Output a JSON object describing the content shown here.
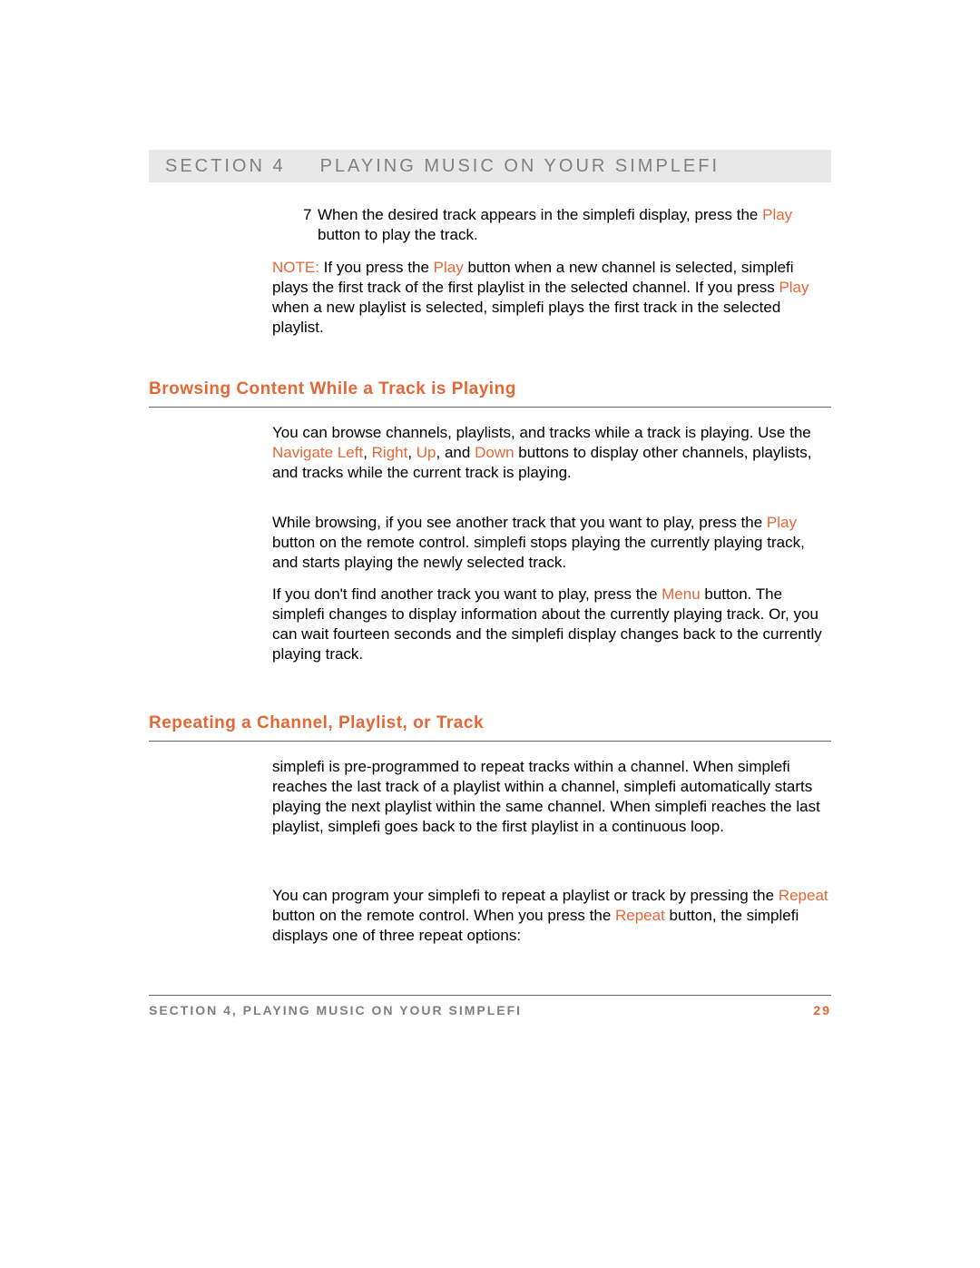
{
  "header": {
    "section": "SECTION 4",
    "title": "PLAYING MUSIC ON YOUR SIMPLEFI"
  },
  "step7": {
    "num": "7",
    "t1": "When the desired track appears in the simplefi display, press the ",
    "play": "Play",
    "t2": " button to play the track."
  },
  "note": {
    "label": "NOTE:",
    "t1": "  If you press the ",
    "play1": "Play",
    "t2": " button when a new channel is selected, simplefi plays the first track of the first playlist in the selected channel.  If you press ",
    "play2": "Play",
    "t3": " when a new playlist is selected, simplefi plays the first track in the selected playlist."
  },
  "h1": "Browsing Content While a Track is Playing",
  "p1": {
    "t1": "You can browse channels, playlists, and tracks while a track is playing.  Use the ",
    "left": "Navigate Left",
    "c1": ", ",
    "right": "Right",
    "c2": ", ",
    "up": "Up",
    "c3": ", and ",
    "down": "Down",
    "t2": " buttons to display other channels, playlists, and tracks while the current track is playing."
  },
  "p2": {
    "t1": "While browsing, if you see another track that you want to play, press the ",
    "play": "Play",
    "t2": " button on the remote control.  simplefi stops playing the currently playing track, and starts playing the newly selected track."
  },
  "p3": {
    "t1": "If you don't find another track you want to play, press the ",
    "menu": "Menu",
    "t2": " button.  The simplefi changes to display information about the currently playing track.  Or, you can wait fourteen seconds and the simplefi display changes back to the currently playing track."
  },
  "h2": "Repeating a Channel, Playlist, or Track",
  "p4": "simplefi is pre-programmed to repeat tracks within a channel.  When simplefi reaches the last track of a playlist within a channel, simplefi automatically starts playing the next playlist within the same channel.  When simplefi reaches the last playlist, simplefi goes back to the first playlist in a continuous loop.",
  "p5": {
    "t1": "You can program your simplefi to repeat a playlist or track by pressing the ",
    "r1": "Repeat",
    "t2": " button on the remote control.  When you press the ",
    "r2": "Repeat",
    "t3": " button, the simplefi displays one of three repeat options:"
  },
  "footer": {
    "text": "SECTION 4, PLAYING MUSIC ON YOUR SIMPLEFI",
    "page": "29"
  }
}
